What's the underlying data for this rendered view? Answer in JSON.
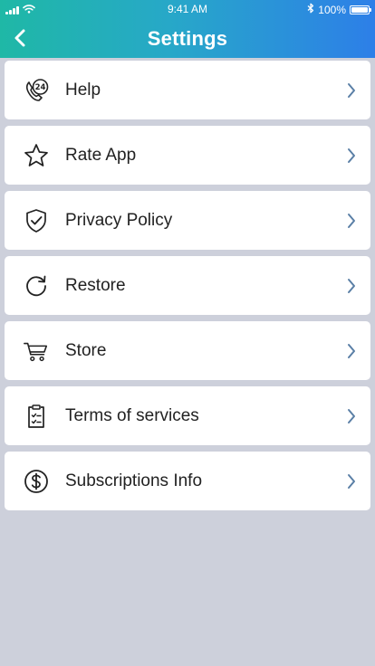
{
  "status_bar": {
    "time": "9:41 AM",
    "battery": "100%",
    "battery_level": 1.0,
    "signal_icon": "cellular-signal-icon",
    "wifi_icon": "wifi-icon",
    "bluetooth_icon": "bluetooth-icon"
  },
  "header": {
    "title": "Settings",
    "back_icon": "chevron-left-icon",
    "gradient": [
      "#1fb8a6",
      "#27a8c8",
      "#2d7fe8"
    ]
  },
  "colors": {
    "background": "#cdd0db",
    "card": "#ffffff",
    "text": "#222222",
    "chevron": "#5a7fa6"
  },
  "menu": {
    "items": [
      {
        "label": "Help",
        "icon": "support-24-icon"
      },
      {
        "label": "Rate App",
        "icon": "star-icon"
      },
      {
        "label": "Privacy Policy",
        "icon": "shield-check-icon"
      },
      {
        "label": "Restore",
        "icon": "refresh-icon"
      },
      {
        "label": "Store",
        "icon": "cart-icon"
      },
      {
        "label": "Terms of services",
        "icon": "clipboard-icon"
      },
      {
        "label": "Subscriptions Info",
        "icon": "dollar-circle-icon"
      }
    ]
  }
}
